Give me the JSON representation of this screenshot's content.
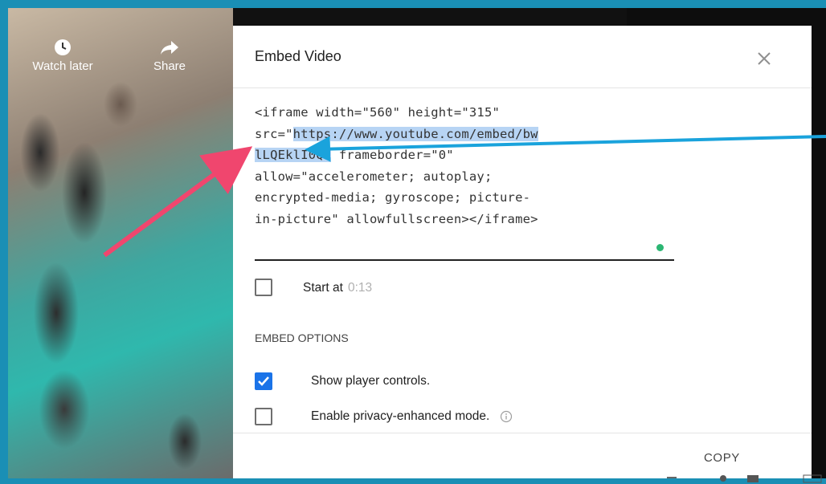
{
  "video_controls": {
    "watch_later_label": "Watch later",
    "share_label": "Share"
  },
  "dialog": {
    "title": "Embed Video",
    "code_lines": [
      {
        "pre": "<iframe width=\"560\" height=\"315\"",
        "hl": "",
        "post": ""
      },
      {
        "pre": "src=\"",
        "hl": "https://www.youtube.com/embed/bw",
        "post": ""
      },
      {
        "pre": "",
        "hl": "lLQEklI0Q\"",
        "post": " frameborder=\"0\""
      },
      {
        "pre": "allow=\"accelerometer; autoplay;",
        "hl": "",
        "post": ""
      },
      {
        "pre": "encrypted-media; gyroscope; picture-",
        "hl": "",
        "post": ""
      },
      {
        "pre": "in-picture\" allowfullscreen></iframe>",
        "hl": "",
        "post": ""
      }
    ],
    "start_at_label": "Start at",
    "start_at_time": "0:13",
    "embed_options_heading": "EMBED OPTIONS",
    "options": [
      {
        "label": "Show player controls.",
        "checked": true
      },
      {
        "label": "Enable privacy-enhanced mode.",
        "checked": false
      }
    ],
    "copy_label": "COPY"
  },
  "annotations": {
    "arrow_pink_color": "#f0466e",
    "arrow_blue_color": "#1aa3dc"
  },
  "colors": {
    "frame_border": "#1a8fb5",
    "checkbox_accent": "#1a73e8",
    "highlight": "#b7d4f4",
    "status_dot": "#2bb673"
  }
}
